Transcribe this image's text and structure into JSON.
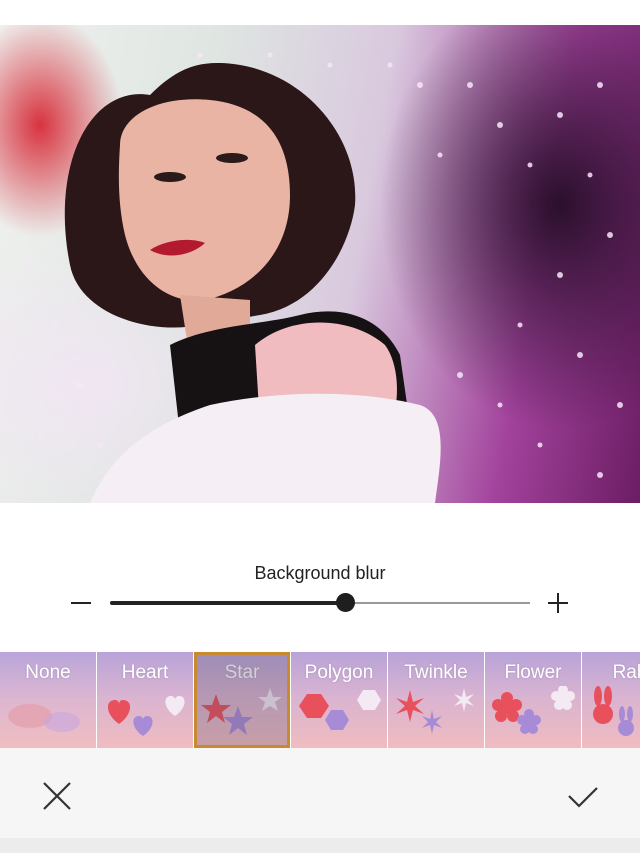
{
  "photo": {
    "description_icon": "portrait-photo-with-star-bokeh"
  },
  "blur": {
    "title": "Background blur",
    "level_percent": 56,
    "minus_icon": "minus-icon",
    "plus_icon": "plus-icon"
  },
  "effects": [
    {
      "label": "None"
    },
    {
      "label": "Heart"
    },
    {
      "label": "Star",
      "selected": true
    },
    {
      "label": "Polygon"
    },
    {
      "label": "Twinkle"
    },
    {
      "label": "Flower"
    },
    {
      "label": "Rab"
    }
  ],
  "actions": {
    "cancel_icon": "close-icon",
    "confirm_icon": "checkmark-icon"
  },
  "colors": {
    "selection_border": "#f0a122",
    "shape_red": "#e8505b",
    "shape_violet": "#a78bd6",
    "shape_light": "#f4eaf4"
  }
}
